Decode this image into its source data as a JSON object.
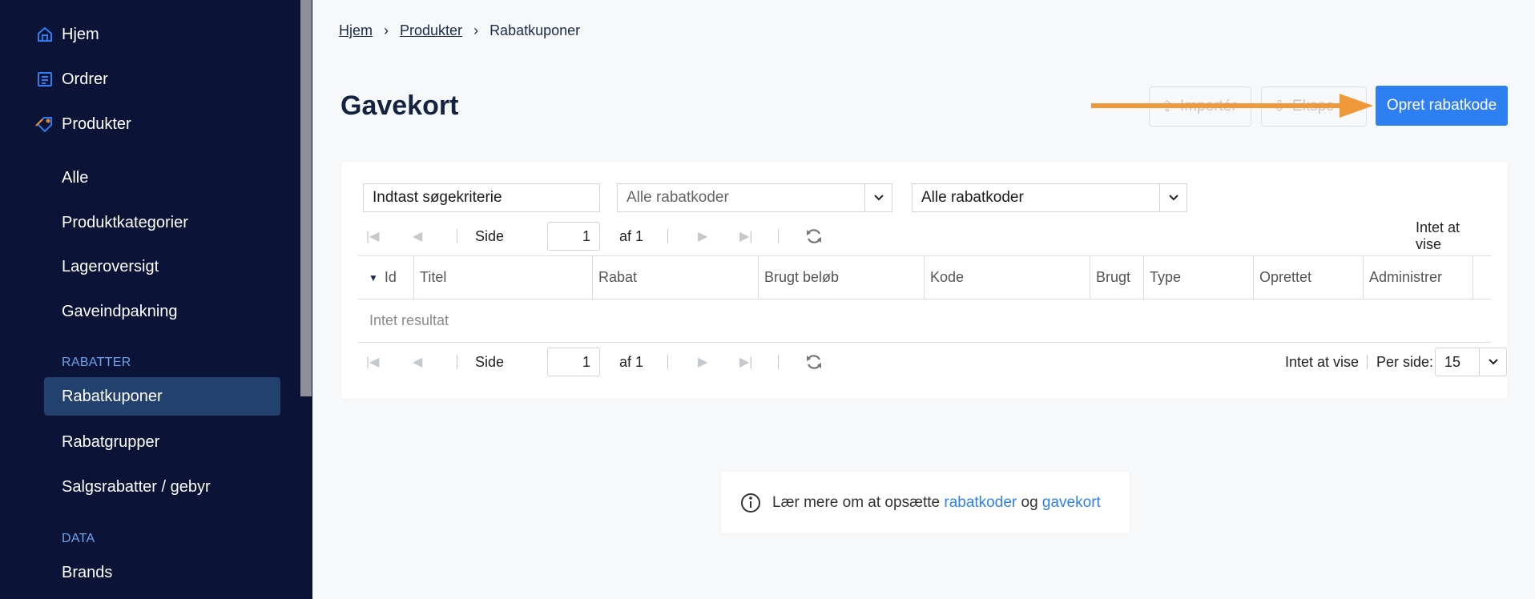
{
  "sidebar": {
    "top_items": [
      {
        "label": "Hjem",
        "icon": "home-icon"
      },
      {
        "label": "Ordrer",
        "icon": "orders-icon"
      },
      {
        "label": "Produkter",
        "icon": "tag-icon"
      }
    ],
    "products_sub": [
      "Alle",
      "Produktkategorier",
      "Lageroversigt",
      "Gaveindpakning"
    ],
    "section_rabatter": "RABATTER",
    "rabatter_items": [
      "Rabatkuponer",
      "Rabatgrupper",
      "Salgsrabatter / gebyr"
    ],
    "section_data": "DATA",
    "data_items": [
      "Brands"
    ],
    "active_item": "Rabatkuponer",
    "icon_accent": "#2e7ff1",
    "tag_icon_color": "#f08c2e"
  },
  "breadcrumb": {
    "items": [
      "Hjem",
      "Produkter",
      "Rabatkuponer"
    ]
  },
  "page": {
    "title": "Gavekort"
  },
  "toolbar": {
    "import_label": "Importér",
    "export_label": "Ekspo",
    "create_label": "Opret rabatkode",
    "primary_color": "#2e7ff1",
    "arrow_color": "#f0993a"
  },
  "filters": {
    "search_value": "Indtast søgekriterie",
    "select1_value": "Alle rabatkoder",
    "select2_value": "Alle rabatkoder"
  },
  "pager": {
    "side_label": "Side",
    "page": "1",
    "of_label": "af 1",
    "nothing_label": "Intet at vise",
    "per_side_label": "Per side:",
    "per_side_value": "15"
  },
  "table": {
    "columns": [
      "Id",
      "Titel",
      "Rabat",
      "Brugt beløb",
      "Kode",
      "Brugt",
      "Type",
      "Oprettet",
      "Administrer"
    ],
    "sort_column": "Id",
    "empty_text": "Intet resultat"
  },
  "info": {
    "prefix": "Lær mere om at opsætte",
    "link1": "rabatkoder",
    "conj": "og",
    "link2": "gavekort"
  }
}
